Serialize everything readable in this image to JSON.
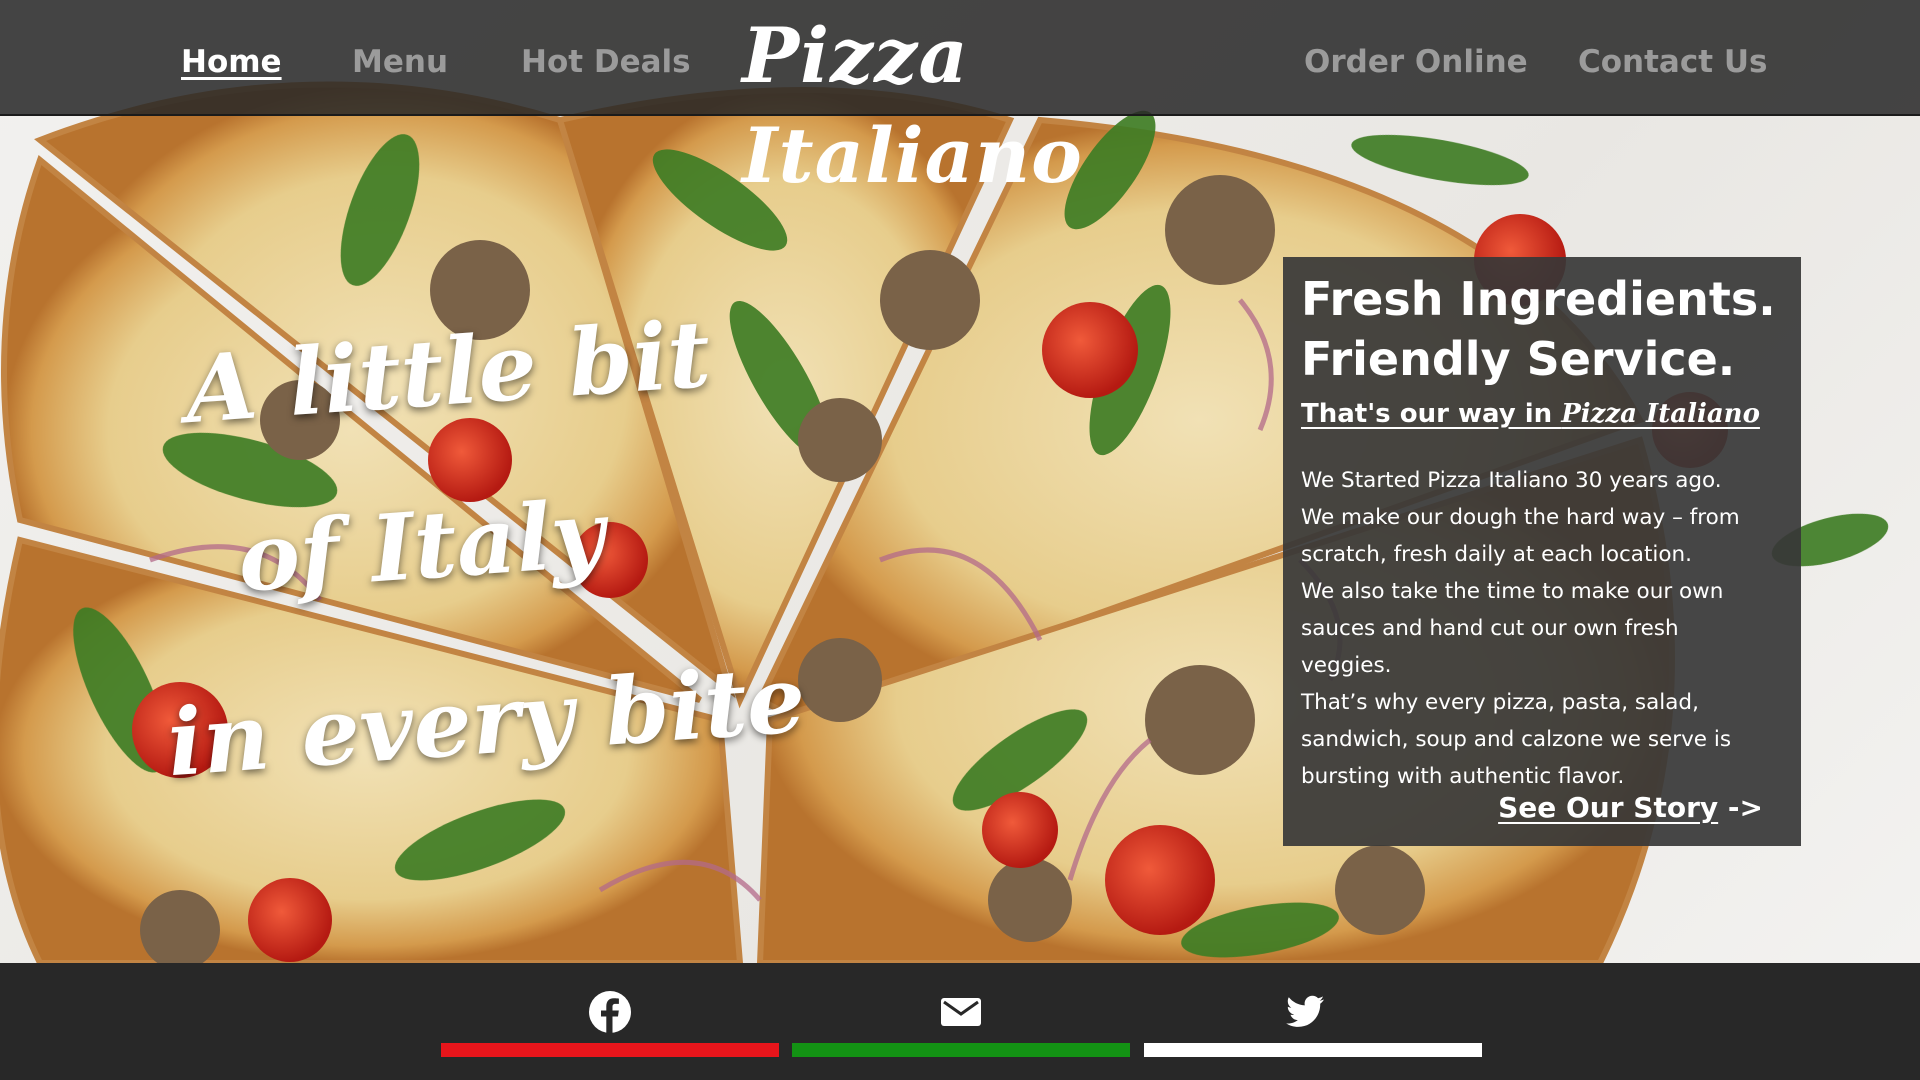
{
  "nav": {
    "home": "Home",
    "menu": "Menu",
    "hot_deals": "Hot Deals",
    "brand": "Pizza Italiano",
    "order_online": "Order Online",
    "contact_us": "Contact Us",
    "active": "Home"
  },
  "hero": {
    "line1": "A little bit",
    "line2": "of Italy",
    "line3": "in every bite"
  },
  "card": {
    "heading_line1": "Fresh Ingredients.",
    "heading_line2": "Friendly Service.",
    "sub_prefix": "That's our way in ",
    "sub_brand": "Pizza Italiano",
    "body": [
      "We Started Pizza Italiano 30 years ago.",
      "We make our dough the hard way – from scratch, fresh daily at each location.",
      "We also take the time to make our own sauces and hand cut our own fresh veggies.",
      "That’s why every pizza, pasta, salad, sandwich, soup and calzone we serve is bursting with authentic flavor."
    ],
    "link_label": "See Our Story",
    "link_arrow": "->"
  },
  "footer": {
    "icons": [
      "facebook-icon",
      "mail-icon",
      "twitter-icon"
    ],
    "flag_colors": [
      "#e8151b",
      "#139214",
      "#ffffff"
    ]
  },
  "colors": {
    "nav_bg": "#282828",
    "nav_inactive": "#9b9b9b",
    "card_bg": "#373737",
    "footer_bg": "#282828"
  }
}
